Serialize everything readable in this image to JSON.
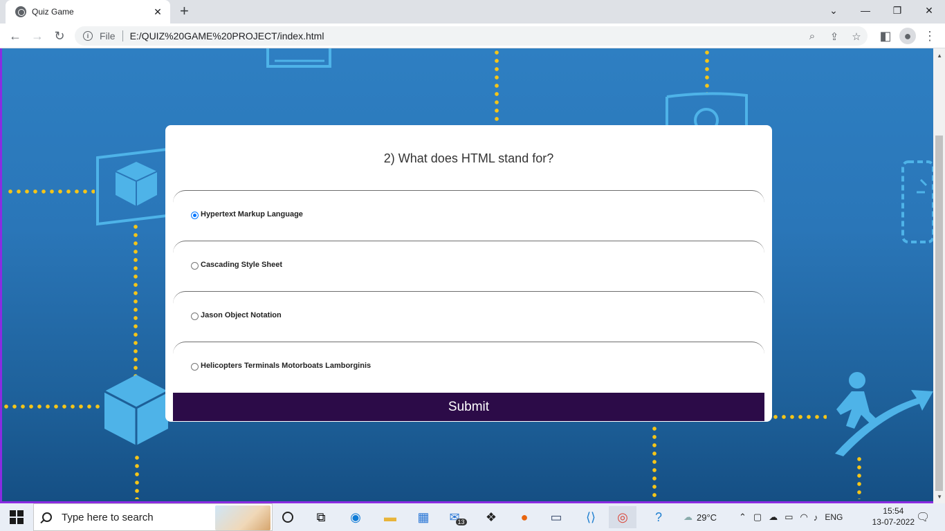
{
  "browser": {
    "tab_title": "Quiz Game",
    "new_tab": "+",
    "file_label": "File",
    "url": "E:/QUIZ%20GAME%20PROJECT/index.html",
    "window_controls": {
      "minimize": "—",
      "restore": "❐",
      "close": "✕",
      "dropdown": "⌄"
    }
  },
  "quiz": {
    "question": "2) What does HTML stand for?",
    "options": [
      {
        "label": "Hypertext Markup Language",
        "checked": true
      },
      {
        "label": "Cascading Style Sheet",
        "checked": false
      },
      {
        "label": "Jason Object Notation",
        "checked": false
      },
      {
        "label": "Helicopters Terminals Motorboats Lamborginis",
        "checked": false
      }
    ],
    "submit_label": "Submit"
  },
  "colors": {
    "background_top": "#2e7fc2",
    "background_bottom": "#154f84",
    "frame_border": "#8a2be2",
    "dot_accent": "#f5c518",
    "submit_bg": "#2c0b48",
    "radio_accent": "#0075ff"
  },
  "taskbar": {
    "search_placeholder": "Type here to search",
    "mail_badge": "13",
    "weather": "29°C",
    "language": "ENG",
    "time": "15:54",
    "date": "13-07-2022"
  }
}
